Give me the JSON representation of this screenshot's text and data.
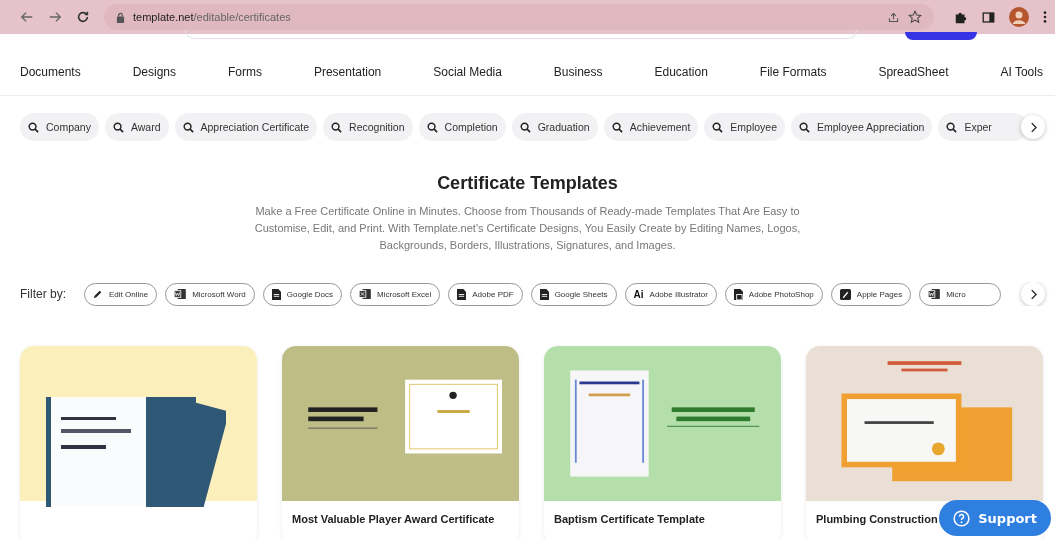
{
  "browser": {
    "url_host": "template.net",
    "url_path": "/editable/certificates"
  },
  "nav": [
    "Documents",
    "Designs",
    "Forms",
    "Presentation",
    "Social Media",
    "Business",
    "Education",
    "File Formats",
    "SpreadSheet",
    "AI Tools"
  ],
  "search_chips": [
    "Company",
    "Award",
    "Appreciation Certificate",
    "Recognition",
    "Completion",
    "Graduation",
    "Achievement",
    "Employee",
    "Employee Appreciation",
    "Exper"
  ],
  "heading": "Certificate Templates",
  "description": "Make a Free Certificate Online in Minutes. Choose from Thousands of Ready-made Templates That Are Easy to Customise, Edit, and Print. With Template.net's Certificate Designs, You Easily Create by Editing Names, Logos, Backgrounds, Borders, Illustrations, Signatures, and Images.",
  "filter": {
    "label": "Filter by:",
    "items": [
      {
        "label": "Edit Online",
        "kind": "pencil"
      },
      {
        "label": "Microsoft Word",
        "kind": "word"
      },
      {
        "label": "Google Docs",
        "kind": "doc"
      },
      {
        "label": "Microsoft Excel",
        "kind": "excel"
      },
      {
        "label": "Adobe PDF",
        "kind": "doc"
      },
      {
        "label": "Google Sheets",
        "kind": "doc"
      },
      {
        "label": "Adobe Illustrator",
        "kind": "text",
        "badge": "Ai"
      },
      {
        "label": "Adobe PhotoShop",
        "kind": "photoshop"
      },
      {
        "label": "Apple Pages",
        "kind": "pages"
      },
      {
        "label": "Micro",
        "kind": "word"
      }
    ]
  },
  "cards": [
    {
      "kind": "completion",
      "color": "#fbefbb"
    },
    {
      "title": "Most Valuable Player Award Certificate",
      "kind": "award",
      "color": "#bdbd85"
    },
    {
      "title": "Baptism Certificate Template",
      "kind": "baptism",
      "color": "#b5dfaa"
    },
    {
      "title": "Plumbing Construction",
      "kind": "plumbing",
      "color": "#e9dfd5"
    }
  ],
  "support": {
    "label": "Support"
  }
}
